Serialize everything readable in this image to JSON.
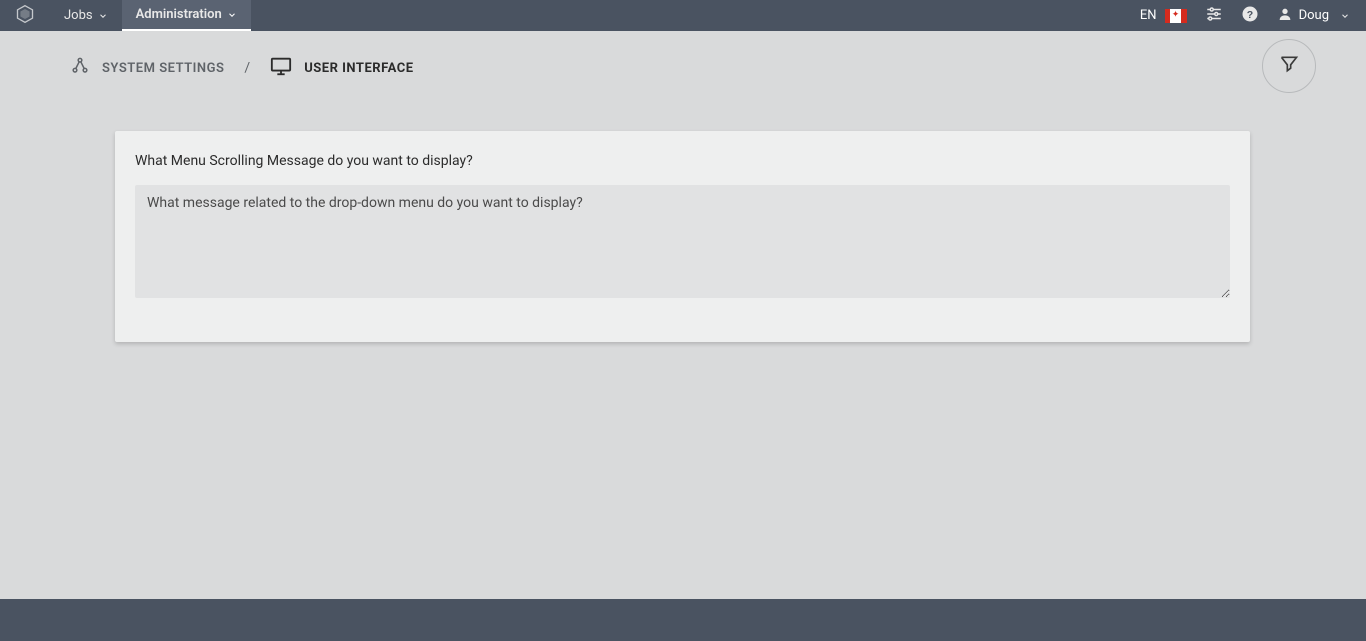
{
  "topbar": {
    "nav": {
      "jobs": "Jobs",
      "admin": "Administration"
    },
    "right": {
      "lang": "EN",
      "user": "Doug"
    }
  },
  "breadcrumb": {
    "systemSettings": "SYSTEM SETTINGS",
    "sep": "/",
    "userInterface": "USER INTERFACE"
  },
  "card": {
    "label": "What Menu Scrolling Message do you want to display?",
    "placeholder": "What message related to the drop-down menu do you want to display?"
  }
}
